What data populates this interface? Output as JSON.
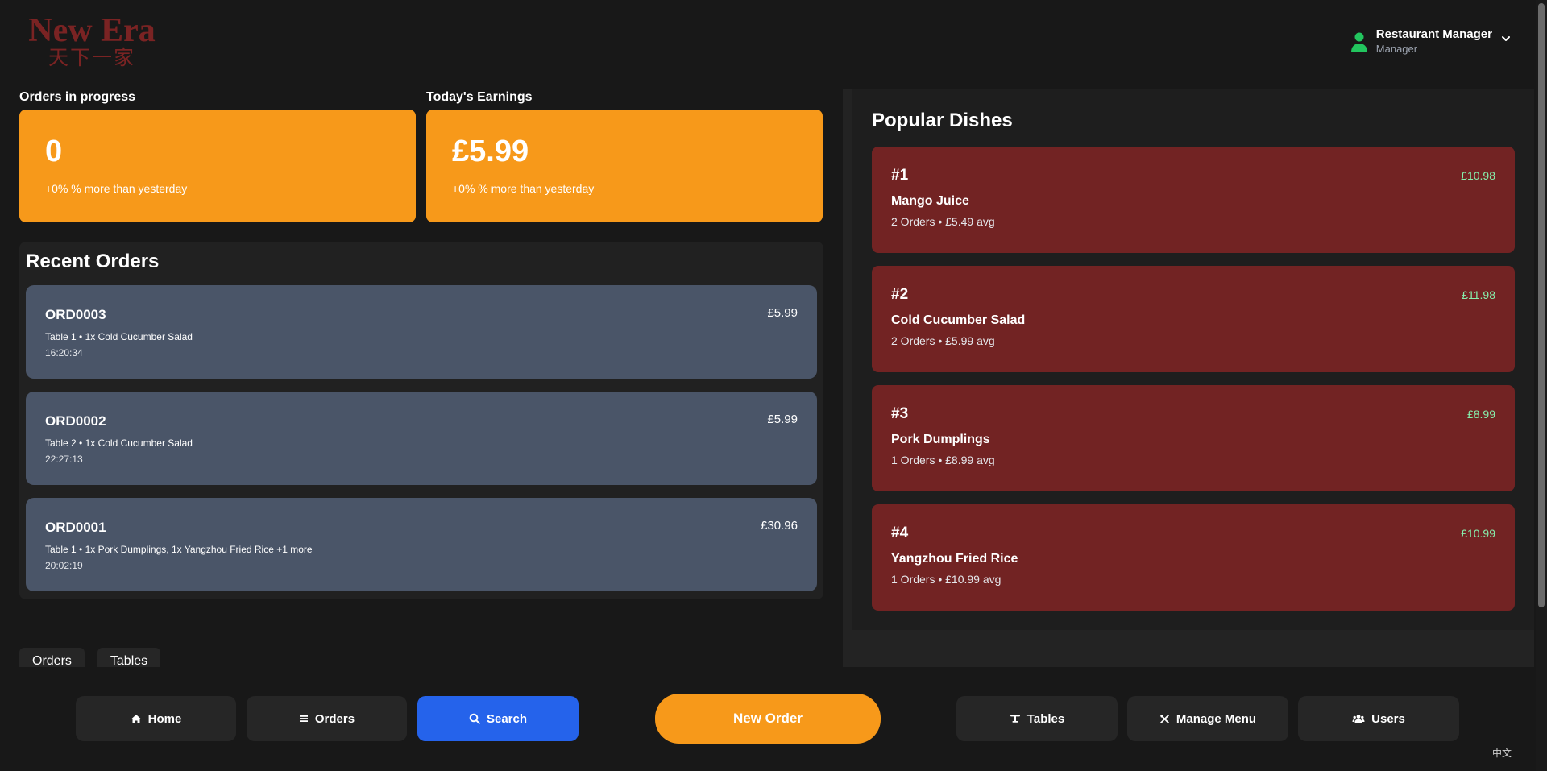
{
  "brand": {
    "name_en": "New Era",
    "name_zh": "天下一家"
  },
  "user": {
    "name": "Restaurant Manager",
    "role": "Manager"
  },
  "stats": [
    {
      "label": "Orders in progress",
      "value": "0",
      "sub": "+0% % more than yesterday"
    },
    {
      "label": "Today's Earnings",
      "value": "£5.99",
      "sub": "+0% % more than yesterday"
    }
  ],
  "recent_orders": {
    "title": "Recent Orders",
    "items": [
      {
        "id": "ORD0003",
        "desc": "Table 1 • 1x Cold Cucumber Salad",
        "time": "16:20:34",
        "amount": "£5.99"
      },
      {
        "id": "ORD0002",
        "desc": "Table 2 • 1x Cold Cucumber Salad",
        "time": "22:27:13",
        "amount": "£5.99"
      },
      {
        "id": "ORD0001",
        "desc": "Table 1 • 1x Pork Dumplings, 1x Yangzhou Fried Rice +1 more",
        "time": "20:02:19",
        "amount": "£30.96"
      }
    ]
  },
  "bottom_tabs": [
    "Orders",
    "Tables"
  ],
  "popular": {
    "title": "Popular Dishes",
    "items": [
      {
        "rank": "#1",
        "name": "Mango Juice",
        "meta": "2 Orders • £5.49 avg",
        "total": "£10.98"
      },
      {
        "rank": "#2",
        "name": "Cold Cucumber Salad",
        "meta": "2 Orders • £5.99 avg",
        "total": "£11.98"
      },
      {
        "rank": "#3",
        "name": "Pork Dumplings",
        "meta": "1 Orders • £8.99 avg",
        "total": "£8.99"
      },
      {
        "rank": "#4",
        "name": "Yangzhou Fried Rice",
        "meta": "1 Orders • £10.99 avg",
        "total": "£10.99"
      }
    ]
  },
  "nav": {
    "home": "Home",
    "orders": "Orders",
    "search": "Search",
    "new_order": "New Order",
    "tables": "Tables",
    "manage_menu": "Manage Menu",
    "users": "Users"
  },
  "language_toggle": "中文",
  "colors": {
    "accent_orange": "#f7991a",
    "dish_card": "#722323",
    "order_card": "#4a5568",
    "active_nav": "#2563eb",
    "price_green": "#86efac",
    "brand_red": "#7a2323"
  }
}
